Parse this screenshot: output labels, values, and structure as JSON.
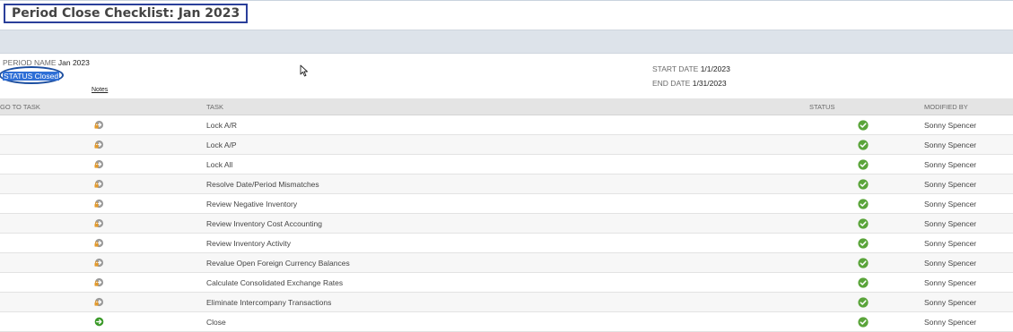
{
  "page": {
    "title": "Period Close Checklist: Jan 2023"
  },
  "period": {
    "name_label": "PERIOD NAME",
    "name_value": "Jan 2023",
    "status_label": "STATUS",
    "status_value": "Closed",
    "notes_link": "Notes",
    "start_label": "START DATE",
    "start_value": "1/1/2023",
    "end_label": "END DATE",
    "end_value": "1/31/2023"
  },
  "table": {
    "headers": {
      "go_to_task": "GO TO TASK",
      "task": "TASK",
      "status": "STATUS",
      "modified_by": "MODIFIED BY"
    },
    "rows": [
      {
        "go_icon": "locked-arrow-icon",
        "task": "Lock A/R",
        "status_icon": "check-circle-icon",
        "modified_by": "Sonny Spencer"
      },
      {
        "go_icon": "locked-arrow-icon",
        "task": "Lock A/P",
        "status_icon": "check-circle-icon",
        "modified_by": "Sonny Spencer"
      },
      {
        "go_icon": "locked-arrow-icon",
        "task": "Lock All",
        "status_icon": "check-circle-icon",
        "modified_by": "Sonny Spencer"
      },
      {
        "go_icon": "locked-arrow-icon",
        "task": "Resolve Date/Period Mismatches",
        "status_icon": "check-circle-icon",
        "modified_by": "Sonny Spencer"
      },
      {
        "go_icon": "locked-arrow-icon",
        "task": "Review Negative Inventory",
        "status_icon": "check-circle-icon",
        "modified_by": "Sonny Spencer"
      },
      {
        "go_icon": "locked-arrow-icon",
        "task": "Review Inventory Cost Accounting",
        "status_icon": "check-circle-icon",
        "modified_by": "Sonny Spencer"
      },
      {
        "go_icon": "locked-arrow-icon",
        "task": "Review Inventory Activity",
        "status_icon": "check-circle-icon",
        "modified_by": "Sonny Spencer"
      },
      {
        "go_icon": "locked-arrow-icon",
        "task": "Revalue Open Foreign Currency Balances",
        "status_icon": "check-circle-icon",
        "modified_by": "Sonny Spencer"
      },
      {
        "go_icon": "locked-arrow-icon",
        "task": "Calculate Consolidated Exchange Rates",
        "status_icon": "check-circle-icon",
        "modified_by": "Sonny Spencer"
      },
      {
        "go_icon": "locked-arrow-icon",
        "task": "Eliminate Intercompany Transactions",
        "status_icon": "check-circle-icon",
        "modified_by": "Sonny Spencer"
      },
      {
        "go_icon": "go-arrow-icon",
        "task": "Close",
        "status_icon": "check-circle-icon",
        "modified_by": "Sonny Spencer"
      }
    ]
  },
  "colors": {
    "title_border": "#2a3f9a",
    "status_highlight": "#2f6fd6",
    "status_oval": "#1d4fa0",
    "check_green": "#5aa43a",
    "go_green": "#3c9a2a",
    "lock_orange": "#e39a2c",
    "band": "#dde3ea"
  }
}
